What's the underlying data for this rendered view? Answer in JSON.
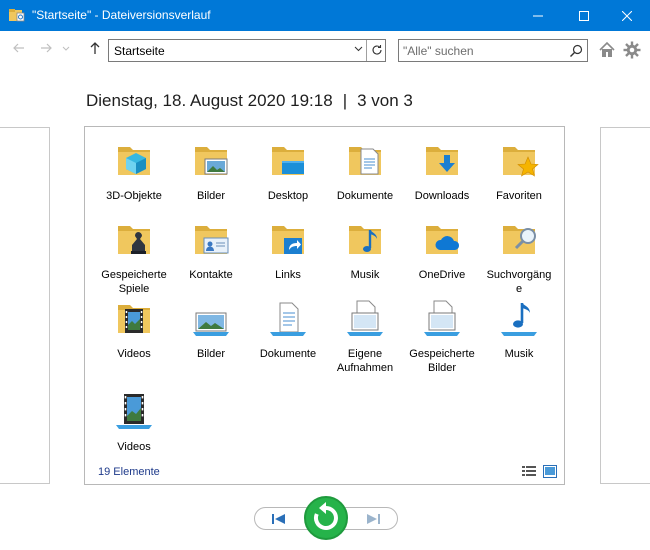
{
  "window": {
    "title": "\"Startseite\" - Dateiversionsverlauf",
    "controls": {
      "minimize": "—",
      "maximize": "☐",
      "close": "✕"
    }
  },
  "toolbar": {
    "address": "Startseite",
    "search_placeholder": "\"Alle\" suchen"
  },
  "header": {
    "date": "Dienstag, 18. August 2020 19:18",
    "separator": "|",
    "position": "3 von 3"
  },
  "items": [
    {
      "label": "3D-Objekte",
      "icon": "folder-3d-icon"
    },
    {
      "label": "Bilder",
      "icon": "folder-pictures-icon"
    },
    {
      "label": "Desktop",
      "icon": "folder-desktop-icon"
    },
    {
      "label": "Dokumente",
      "icon": "folder-documents-icon"
    },
    {
      "label": "Downloads",
      "icon": "folder-downloads-icon"
    },
    {
      "label": "Favoriten",
      "icon": "folder-favorites-icon"
    },
    {
      "label": "Gespeicherte Spiele",
      "icon": "folder-saved-games-icon"
    },
    {
      "label": "Kontakte",
      "icon": "folder-contacts-icon"
    },
    {
      "label": "Links",
      "icon": "folder-links-icon"
    },
    {
      "label": "Musik",
      "icon": "folder-music-icon"
    },
    {
      "label": "OneDrive",
      "icon": "folder-onedrive-icon"
    },
    {
      "label": "Suchvorgänge",
      "icon": "folder-searches-icon"
    },
    {
      "label": "Videos",
      "icon": "folder-videos-icon"
    },
    {
      "label": "Bilder",
      "icon": "library-pictures-icon"
    },
    {
      "label": "Dokumente",
      "icon": "library-documents-icon"
    },
    {
      "label": "Eigene Aufnahmen",
      "icon": "library-recordings-icon"
    },
    {
      "label": "Gespeicherte Bilder",
      "icon": "library-saved-pictures-icon"
    },
    {
      "label": "Musik",
      "icon": "library-music-icon"
    },
    {
      "label": "Videos",
      "icon": "library-videos-icon"
    }
  ],
  "status": {
    "count": "19 Elemente"
  },
  "colors": {
    "accent": "#0078d7",
    "restore": "#26b34a",
    "folder": "#f0c75e"
  }
}
